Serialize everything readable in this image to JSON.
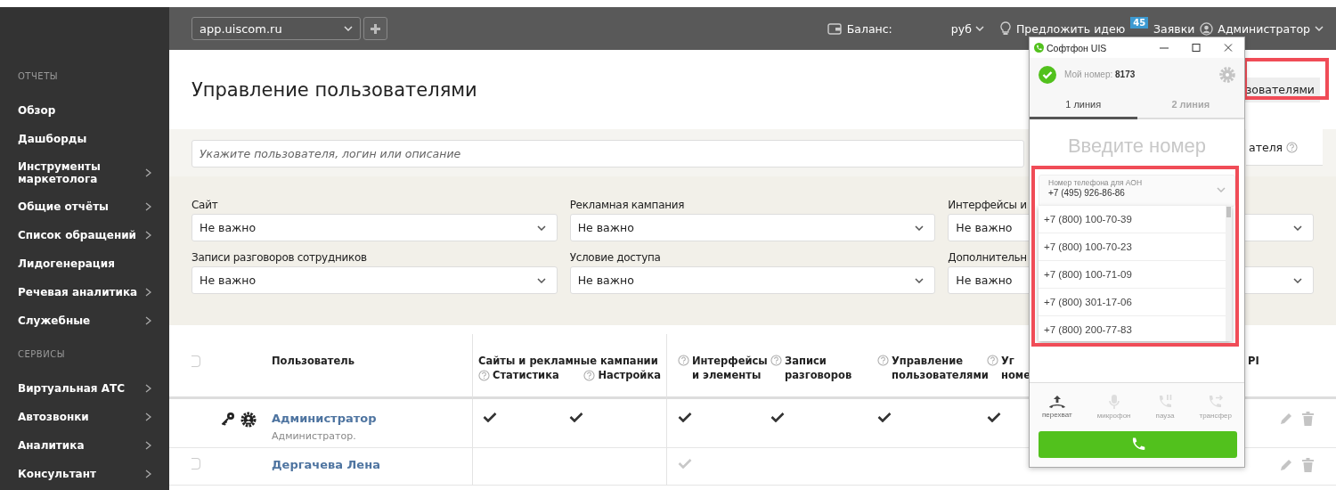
{
  "topbar": {
    "site_select": {
      "value": "app.uiscom.ru"
    },
    "balance_label": "Баланс:",
    "currency": "руб",
    "idea_link": "Предложить идею",
    "requests_badge": "45",
    "requests_link": "Заявки",
    "user_menu": "Администратор"
  },
  "sidebar": {
    "sections": [
      {
        "title": "ОТЧЕТЫ",
        "items": [
          {
            "label": "Обзор",
            "has_submenu": false
          },
          {
            "label": "Дашборды",
            "has_submenu": false
          },
          {
            "label": "Инструменты маркетолога",
            "has_submenu": true
          },
          {
            "label": "Общие отчёты",
            "has_submenu": true
          },
          {
            "label": "Список обращений",
            "has_submenu": true
          },
          {
            "label": "Лидогенерация",
            "has_submenu": false
          },
          {
            "label": "Речевая аналитика",
            "has_submenu": true
          },
          {
            "label": "Служебные",
            "has_submenu": true
          }
        ]
      },
      {
        "title": "СЕРВИСЫ",
        "items": [
          {
            "label": "Виртуальная АТС",
            "has_submenu": true
          },
          {
            "label": "Автозвонки",
            "has_submenu": true
          },
          {
            "label": "Аналитика",
            "has_submenu": true
          },
          {
            "label": "Консультант",
            "has_submenu": true
          }
        ]
      }
    ]
  },
  "page": {
    "title": "Управление пользователями",
    "header_button": "зователями",
    "search": {
      "placeholder": "Укажите пользователя, логин или описание"
    },
    "side_link": {
      "label": "ателя",
      "help": true
    }
  },
  "filters": [
    {
      "label": "Сайт",
      "value": "Не важно"
    },
    {
      "label": "Рекламная кампания",
      "value": "Не важно"
    },
    {
      "label": "Интерфейсы и",
      "value": "Не важно"
    },
    {
      "label": "Записи разговоров сотрудников",
      "value": "Не важно"
    },
    {
      "label": "Условие доступа",
      "value": "Не важно"
    },
    {
      "label": "Дополнительн",
      "value": "Не важно"
    }
  ],
  "table": {
    "select_all_checked": false,
    "user_column": "Пользователь",
    "group_column": {
      "label": "Сайты и рекламные кампании",
      "children": [
        {
          "label": "Статистика",
          "help": true
        },
        {
          "label": "Настройка",
          "help": true
        }
      ]
    },
    "columns": [
      {
        "label": "Интерфейсы и элементы",
        "help": true
      },
      {
        "label": "Записи разговоров",
        "help": true
      },
      {
        "label": "Управление пользователями",
        "help": true
      },
      {
        "label": "Уг номе",
        "help": true
      }
    ],
    "last_column": "PI",
    "rows": [
      {
        "kind": "admin",
        "name": "Администратор",
        "description": "Администратор.",
        "access": [
          {
            "checked": true,
            "dimmed": false
          },
          {
            "checked": true,
            "dimmed": false
          },
          {
            "checked": true,
            "dimmed": false
          },
          {
            "checked": true,
            "dimmed": false
          },
          {
            "checked": true,
            "dimmed": false
          },
          {
            "checked": true,
            "dimmed": false
          }
        ]
      },
      {
        "kind": "user",
        "name": "Дергачева Лена",
        "checked": false,
        "access": [
          {
            "checked": false
          },
          {
            "checked": false
          },
          {
            "checked": true,
            "dimmed": true
          },
          {
            "checked": false
          },
          {
            "checked": false
          },
          {
            "checked": false
          }
        ]
      }
    ]
  },
  "softphone": {
    "title": "Софтфон UIS",
    "online": true,
    "my_number": "Мой номер: **8173**",
    "lines": [
      {
        "label": "1 линия",
        "selected": true
      },
      {
        "label": "2 линия",
        "selected": false
      }
    ],
    "number_input": {
      "placeholder": "Введите номер"
    },
    "caller_id": {
      "label": "Номер телефона для АОН",
      "value": "+7 (495) 926-86-86",
      "expanded": true,
      "options": [
        "+7 (800) 100-70-39",
        "+7 (800) 100-70-23",
        "+7 (800) 100-71-09",
        "+7 (800) 301-17-06",
        "+7 (800) 200-77-83"
      ]
    },
    "actions": [
      {
        "kind": "pickup",
        "label": "перехват",
        "disabled": false
      },
      {
        "kind": "mic",
        "label": "микрофон",
        "disabled": true
      },
      {
        "kind": "pause",
        "label": "пауза",
        "disabled": true
      },
      {
        "kind": "transfer",
        "label": "трансфер",
        "disabled": true
      }
    ]
  }
}
